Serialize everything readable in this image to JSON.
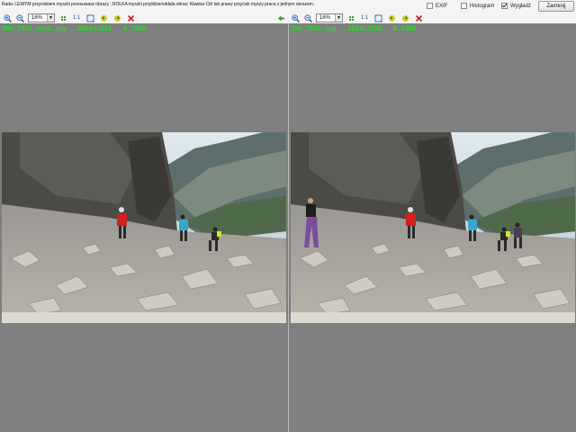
{
  "topbar": {
    "hint": "Rada: LEWYM przyciskiem myszki przesuwasz obrazy ; ROLKA myszki przybliża/oddala obraz; Klawisz Ctrl lub prawy przycisk myszy praca z jednym obrazem.",
    "options": [
      {
        "label": "EXIF",
        "checked": false
      },
      {
        "label": "Histogram",
        "checked": false
      },
      {
        "label": "Wygładź",
        "checked": true
      }
    ],
    "close_label": "Zamknij"
  },
  "toolbar_left": {
    "zoom_value": "16%",
    "icons": [
      "zoom-in-icon",
      "zoom-out-icon",
      "fit-icon",
      "actual-size-icon",
      "fit-window-icon",
      "rotate-left-icon",
      "rotate-right-icon",
      "delete-icon"
    ]
  },
  "toolbar_right": {
    "zoom_value": "16%",
    "icons": [
      "back-arrow-icon",
      "zoom-in-icon",
      "zoom-out-icon",
      "fit-icon",
      "actual-size-icon",
      "fit-window-icon",
      "rotate-left-icon",
      "rotate-right-icon",
      "delete-icon"
    ]
  },
  "left_image": {
    "info": "IMG_7545.w4x2.jpg , 3888x2592 , 0.75MB"
  },
  "right_image": {
    "info": "IMG_7545.jpg , 3888x2592 , 0.68MB"
  },
  "colors": {
    "pane_bg": "#7f7f7f",
    "info_text": "#22e022",
    "delete_red": "#d21f1f",
    "icon_green": "#2a9a2a",
    "icon_blue": "#3d72c8"
  }
}
